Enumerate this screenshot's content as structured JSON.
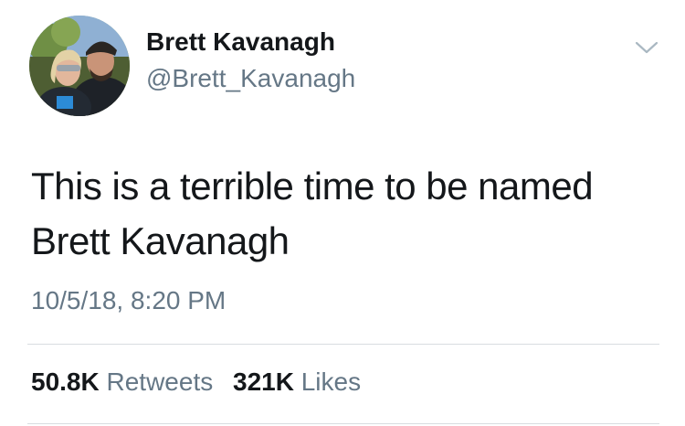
{
  "user": {
    "display_name": "Brett Kavanagh",
    "handle": "@Brett_Kavanagh"
  },
  "tweet": {
    "text": "This is a terrible time to be named Brett Kavanagh",
    "timestamp": "10/5/18, 8:20 PM"
  },
  "stats": {
    "retweets": {
      "count": "50.8K",
      "label": "Retweets"
    },
    "likes": {
      "count": "321K",
      "label": "Likes"
    }
  },
  "icons": {
    "menu": "chevron-down-icon"
  },
  "colors": {
    "text_primary": "#14171a",
    "text_secondary": "#657786",
    "divider": "#d8dde1"
  }
}
